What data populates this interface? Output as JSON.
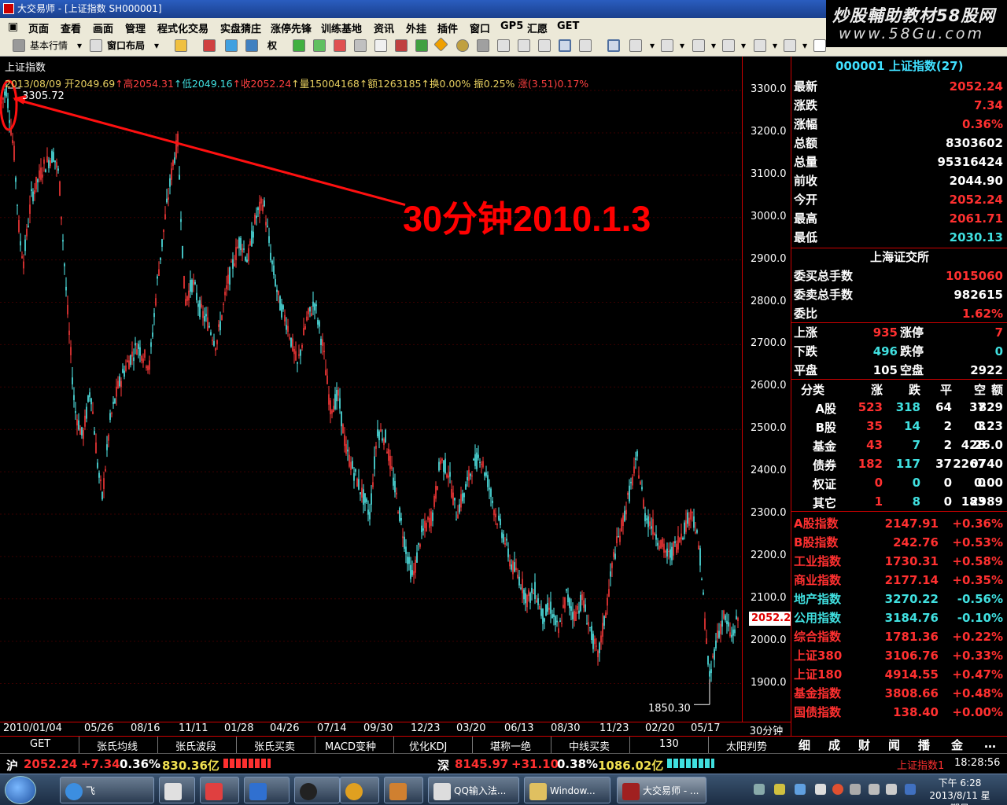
{
  "window": {
    "title": "大交易师 - [上证指数 SH000001]"
  },
  "watermark": {
    "line1": "炒股輔助教材58股网",
    "line2": "www.58Gu.com"
  },
  "menu": [
    "页面",
    "查看",
    "画面",
    "管理",
    "程式化交易",
    "实盘猜庄",
    "涨停先锋",
    "训练基地",
    "资讯",
    "外挂",
    "插件",
    "窗口",
    "GP5",
    "汇愿",
    "GET"
  ],
  "toolbar": {
    "market": "基本行情",
    "layout": "窗口布局",
    "rights": "权"
  },
  "chart": {
    "title": "上证指数",
    "info": {
      "date": "2013/08/09",
      "open": "开2049.69",
      "high": "↑高2054.31",
      "low": "↑低2049.16",
      "close": "↑收2052.24",
      "vol": "↑量15004168",
      "amt": "↑额1263185",
      "turn": "↑换0.00%",
      "amp": "振0.25%",
      "chg": "涨(3.51)0.17%"
    },
    "annotation": "30分钟2010.1.3",
    "max_label": "3305.72",
    "min_label": "1850.30",
    "current_price": "2052.2",
    "period": "30分钟",
    "colors": {
      "up": "#ff3a3a",
      "down": "#54f0f0",
      "arrow": "#ff1010"
    }
  },
  "chart_data": {
    "type": "candlestick",
    "title": "上证指数",
    "ylim": [
      1810,
      3380
    ],
    "y_ticks": [
      1900.0,
      2000.0,
      2100.0,
      2200.0,
      2300.0,
      2400.0,
      2500.0,
      2600.0,
      2700.0,
      2800.0,
      2900.0,
      3000.0,
      3100.0,
      3200.0,
      3300.0
    ],
    "x_ticks": [
      "2010/01/04",
      "05/26",
      "08/16",
      "11/11",
      "01/28",
      "04/26",
      "07/14",
      "09/30",
      "12/23",
      "03/20",
      "06/13",
      "08/30",
      "11/23",
      "02/20",
      "05/17"
    ],
    "trend_points": [
      [
        0,
        3260
      ],
      [
        8,
        3305
      ],
      [
        18,
        3150
      ],
      [
        25,
        2950
      ],
      [
        30,
        2900
      ],
      [
        40,
        3050
      ],
      [
        55,
        3120
      ],
      [
        68,
        3150
      ],
      [
        75,
        3100
      ],
      [
        85,
        2800
      ],
      [
        95,
        2550
      ],
      [
        105,
        2480
      ],
      [
        115,
        2600
      ],
      [
        125,
        2400
      ],
      [
        130,
        2340
      ],
      [
        140,
        2520
      ],
      [
        150,
        2600
      ],
      [
        160,
        2650
      ],
      [
        175,
        2700
      ],
      [
        190,
        2650
      ],
      [
        200,
        2850
      ],
      [
        210,
        3000
      ],
      [
        220,
        3130
      ],
      [
        226,
        3180
      ],
      [
        235,
        2800
      ],
      [
        245,
        2850
      ],
      [
        255,
        2780
      ],
      [
        265,
        2750
      ],
      [
        275,
        2700
      ],
      [
        290,
        2850
      ],
      [
        305,
        2950
      ],
      [
        315,
        2900
      ],
      [
        325,
        3000
      ],
      [
        335,
        3040
      ],
      [
        345,
        2900
      ],
      [
        355,
        2800
      ],
      [
        365,
        2750
      ],
      [
        378,
        2650
      ],
      [
        390,
        2760
      ],
      [
        400,
        2800
      ],
      [
        410,
        2700
      ],
      [
        420,
        2550
      ],
      [
        430,
        2580
      ],
      [
        440,
        2450
      ],
      [
        450,
        2400
      ],
      [
        460,
        2350
      ],
      [
        470,
        2300
      ],
      [
        480,
        2500
      ],
      [
        490,
        2480
      ],
      [
        500,
        2380
      ],
      [
        510,
        2280
      ],
      [
        520,
        2180
      ],
      [
        525,
        2150
      ],
      [
        535,
        2250
      ],
      [
        550,
        2300
      ],
      [
        560,
        2430
      ],
      [
        570,
        2400
      ],
      [
        580,
        2300
      ],
      [
        590,
        2350
      ],
      [
        600,
        2410
      ],
      [
        610,
        2440
      ],
      [
        620,
        2380
      ],
      [
        630,
        2300
      ],
      [
        640,
        2250
      ],
      [
        650,
        2180
      ],
      [
        660,
        2150
      ],
      [
        670,
        2100
      ],
      [
        680,
        2120
      ],
      [
        690,
        2060
      ],
      [
        700,
        2080
      ],
      [
        710,
        2020
      ],
      [
        720,
        2110
      ],
      [
        730,
        2060
      ],
      [
        740,
        2100
      ],
      [
        750,
        2030
      ],
      [
        760,
        1960
      ],
      [
        770,
        2070
      ],
      [
        780,
        2200
      ],
      [
        790,
        2270
      ],
      [
        800,
        2350
      ],
      [
        810,
        2430
      ],
      [
        820,
        2300
      ],
      [
        830,
        2270
      ],
      [
        840,
        2230
      ],
      [
        850,
        2200
      ],
      [
        860,
        2230
      ],
      [
        870,
        2270
      ],
      [
        880,
        2310
      ],
      [
        890,
        2200
      ],
      [
        898,
        2000
      ],
      [
        902,
        1910
      ],
      [
        910,
        2000
      ],
      [
        920,
        2060
      ],
      [
        930,
        2010
      ],
      [
        938,
        2052
      ]
    ],
    "series": [
      {
        "name": "上证指数",
        "last": 2052.24,
        "max": 3305.72,
        "min": 1850.3
      }
    ]
  },
  "right_panel": {
    "header": "000001 上证指数(27)",
    "quote": [
      {
        "label": "最新",
        "value": "2052.24",
        "color": "red"
      },
      {
        "label": "涨跌",
        "value": "7.34",
        "color": "red"
      },
      {
        "label": "涨幅",
        "value": "0.36%",
        "color": "red"
      },
      {
        "label": "总额",
        "value": "8303602",
        "color": "white"
      },
      {
        "label": "总量",
        "value": "95316424",
        "color": "white"
      },
      {
        "label": "前收",
        "value": "2044.90",
        "color": "white"
      },
      {
        "label": "今开",
        "value": "2052.24",
        "color": "red"
      },
      {
        "label": "最高",
        "value": "2061.71",
        "color": "red"
      },
      {
        "label": "最低",
        "value": "2030.13",
        "color": "cyan"
      }
    ],
    "exchange": "上海证交所",
    "orders": [
      {
        "label": "委买总手数",
        "value": "1015060",
        "color": "red"
      },
      {
        "label": "委卖总手数",
        "value": "982615",
        "color": "white"
      },
      {
        "label": "委比",
        "value": "1.62%",
        "color": "red"
      }
    ],
    "breadth": [
      {
        "l1": "上涨",
        "v1": "935",
        "c1": "red",
        "l2": "涨停",
        "v2": "7",
        "c2": "red"
      },
      {
        "l1": "下跌",
        "v1": "496",
        "c1": "cyan",
        "l2": "跌停",
        "v2": "0",
        "c2": "cyan"
      },
      {
        "l1": "平盘",
        "v1": "105",
        "c1": "white",
        "l2": "空盘",
        "v2": "2922",
        "c2": "white"
      }
    ],
    "class_headers": [
      "分类",
      "涨",
      "跌",
      "平",
      "空",
      "额"
    ],
    "class_rows": [
      [
        "A股",
        "523",
        "318",
        "64",
        "37",
        "829"
      ],
      [
        "B股",
        "35",
        "14",
        "2",
        "3",
        "0.23"
      ],
      [
        "基金",
        "43",
        "7",
        "2",
        "428",
        "26.0"
      ],
      [
        "债券",
        "182",
        "117",
        "37",
        "2267",
        "0740"
      ],
      [
        "权证",
        "0",
        "0",
        "0",
        "0",
        "0.00"
      ],
      [
        "其它",
        "1",
        "8",
        "0",
        "183",
        "2989"
      ]
    ],
    "indices": [
      {
        "name": "A股指数",
        "value": "2147.91",
        "pct": "+0.36%"
      },
      {
        "name": "B股指数",
        "value": "242.76",
        "pct": "+0.53%"
      },
      {
        "name": "工业指数",
        "value": "1730.31",
        "pct": "+0.58%"
      },
      {
        "name": "商业指数",
        "value": "2177.14",
        "pct": "+0.35%"
      },
      {
        "name": "地产指数",
        "value": "3270.22",
        "pct": "-0.56%"
      },
      {
        "name": "公用指数",
        "value": "3184.76",
        "pct": "-0.10%"
      },
      {
        "name": "综合指数",
        "value": "1781.36",
        "pct": "+0.22%"
      },
      {
        "name": "上证380",
        "value": "3106.76",
        "pct": "+0.33%"
      },
      {
        "name": "上证180",
        "value": "4914.55",
        "pct": "+0.47%"
      },
      {
        "name": "基金指数",
        "value": "3808.66",
        "pct": "+0.48%"
      },
      {
        "name": "国债指数",
        "value": "138.40",
        "pct": "+0.00%"
      }
    ],
    "tabs": [
      "细",
      "成",
      "财",
      "闻",
      "播",
      "金",
      "…"
    ]
  },
  "bottom_tabs": [
    "GET",
    "张氏均线",
    "张氏波段",
    "张氏买卖",
    "MACD变种",
    "优化KDJ",
    "堪称一绝",
    "中线买卖",
    "130",
    "太阳判势"
  ],
  "status": {
    "sh_label": "沪",
    "sh_price": "2052.24",
    "sh_chg": "+7.34",
    "sh_pct": "0.36%",
    "sh_amt": "830.36亿",
    "sz_label": "深",
    "sz_price": "8145.97",
    "sz_chg": "+31.10",
    "sz_pct": "0.38%",
    "sz_amt": "1086.02亿",
    "current": "上证指数1",
    "time": "18:28:56"
  },
  "taskbar": {
    "items": [
      "飞",
      "QQ输入法...",
      "Window...",
      "大交易师 - ..."
    ],
    "clock_time": "下午 6:28",
    "clock_date": "2013/8/11 星期日"
  }
}
